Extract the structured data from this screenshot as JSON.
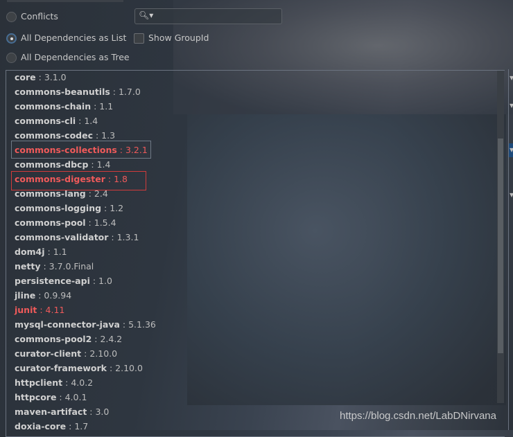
{
  "options": {
    "conflicts": "Conflicts",
    "list": "All Dependencies as List",
    "tree": "All Dependencies as Tree",
    "selected": "list"
  },
  "search": {
    "icon": "search-icon",
    "value": "",
    "placeholder": ""
  },
  "show_group_id": {
    "label": "Show GroupId",
    "checked": false
  },
  "dependencies": [
    {
      "name": "core",
      "version": "3.1.0"
    },
    {
      "name": "commons-beanutils",
      "version": "1.7.0"
    },
    {
      "name": "commons-chain",
      "version": "1.1"
    },
    {
      "name": "commons-cli",
      "version": "1.4"
    },
    {
      "name": "commons-codec",
      "version": "1.3"
    },
    {
      "name": "commons-collections",
      "version": "3.2.1",
      "conflict": true,
      "boxed": true
    },
    {
      "name": "commons-dbcp",
      "version": "1.4"
    },
    {
      "name": "commons-digester",
      "version": "1.8",
      "conflict": true,
      "boxed": true
    },
    {
      "name": "commons-lang",
      "version": "2.4"
    },
    {
      "name": "commons-logging",
      "version": "1.2"
    },
    {
      "name": "commons-pool",
      "version": "1.5.4"
    },
    {
      "name": "commons-validator",
      "version": "1.3.1"
    },
    {
      "name": "dom4j",
      "version": "1.1"
    },
    {
      "name": "netty",
      "version": "3.7.0.Final"
    },
    {
      "name": "persistence-api",
      "version": "1.0"
    },
    {
      "name": "jline",
      "version": "0.9.94"
    },
    {
      "name": "junit",
      "version": "4.11",
      "conflict": true
    },
    {
      "name": "mysql-connector-java",
      "version": "5.1.36"
    },
    {
      "name": "commons-pool2",
      "version": "2.4.2"
    },
    {
      "name": "curator-client",
      "version": "2.10.0"
    },
    {
      "name": "curator-framework",
      "version": "2.10.0"
    },
    {
      "name": "httpclient",
      "version": "4.0.2"
    },
    {
      "name": "httpcore",
      "version": "4.0.1"
    },
    {
      "name": "maven-artifact",
      "version": "3.0"
    },
    {
      "name": "doxia-core",
      "version": "1.7"
    }
  ],
  "separator": " : ",
  "colors": {
    "conflict": "#ef5a5a",
    "highlight_box": "#d23b3b"
  },
  "watermark": "https://blog.csdn.net/LabDNirvana"
}
